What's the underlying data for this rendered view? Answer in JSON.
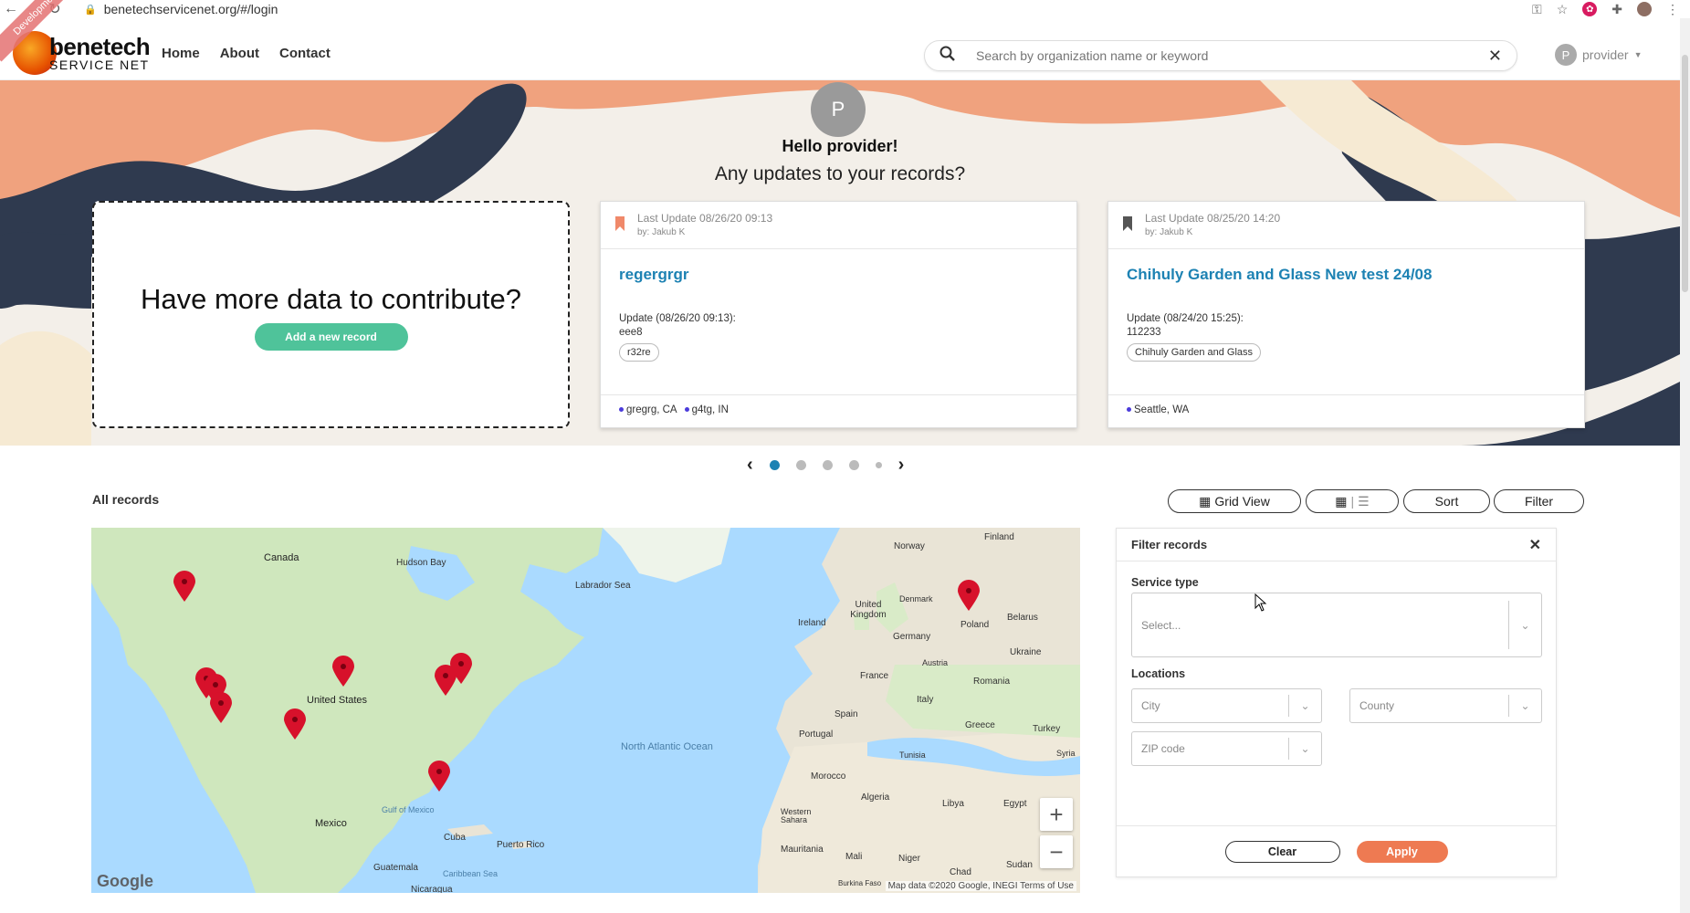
{
  "browser": {
    "url": "benetechservicenet.org/#/login"
  },
  "header": {
    "logo_line1": "benetech",
    "logo_line2": "SERVICE NET",
    "ribbon": "Development",
    "nav": [
      "Home",
      "About",
      "Contact"
    ],
    "search_placeholder": "Search by organization name or keyword",
    "user_initial": "P",
    "user_name": "provider"
  },
  "hero": {
    "avatar_initial": "P",
    "greeting": "Hello provider!",
    "subtitle": "Any updates to your records?"
  },
  "contribute": {
    "title": "Have more data to contribute?",
    "button": "Add a new record"
  },
  "records": [
    {
      "last_update": "Last Update 08/26/20 09:13",
      "by": "by: Jakub K",
      "name": "regergrgr",
      "update_label": "Update (08/26/20 09:13):",
      "update_value": "eee8",
      "tag": "r32re",
      "locations": [
        "gregrg, CA",
        "g4tg, IN"
      ],
      "bookmark_color": "#f0896a"
    },
    {
      "last_update": "Last Update 08/25/20 14:20",
      "by": "by: Jakub K",
      "name": "Chihuly Garden and Glass New test 24/08",
      "update_label": "Update (08/24/20 15:25):",
      "update_value": "112233",
      "tag": "Chihuly Garden and Glass",
      "locations": [
        "Seattle, WA"
      ],
      "bookmark_color": "#555555"
    }
  ],
  "carousel": {
    "pages": 5,
    "active": 0
  },
  "records_section": {
    "title": "All records",
    "grid_view": "Grid View",
    "sort": "Sort",
    "filter": "Filter"
  },
  "map": {
    "labels": {
      "canada": "Canada",
      "hudson": "Hudson Bay",
      "labrador": "Labrador Sea",
      "us": "United States",
      "mexico": "Mexico",
      "gulf": "Gulf of Mexico",
      "cuba": "Cuba",
      "puerto": "Puerto Rico",
      "guatemala": "Guatemala",
      "caribbean": "Caribbean Sea",
      "nicaragua": "Nicaragua",
      "atlantic": "North Atlantic Ocean",
      "finland": "Finland",
      "norway": "Norway",
      "denmark": "Denmark",
      "uk": "United Kingdom",
      "ireland": "Ireland",
      "poland": "Poland",
      "belarus": "Belarus",
      "germany": "Germany",
      "ukraine": "Ukraine",
      "austria": "Austria",
      "france": "France",
      "romania": "Romania",
      "italy": "Italy",
      "spain": "Spain",
      "portugal": "Portugal",
      "greece": "Greece",
      "turkey": "Turkey",
      "syria": "Syria",
      "tunisia": "Tunisia",
      "morocco": "Morocco",
      "algeria": "Algeria",
      "libya": "Libya",
      "egypt": "Egypt",
      "wsahara": "Western Sahara",
      "mauritania": "Mauritania",
      "mali": "Mali",
      "niger": "Niger",
      "chad": "Chad",
      "sudan": "Sudan",
      "burkina": "Burkina Faso"
    },
    "attribution": "Map data ©2020 Google, INEGI   Terms of Use",
    "google": "Google"
  },
  "filter_panel": {
    "title": "Filter records",
    "service_type_label": "Service type",
    "service_type_placeholder": "Select...",
    "locations_label": "Locations",
    "city_placeholder": "City",
    "county_placeholder": "County",
    "zip_placeholder": "ZIP code",
    "clear": "Clear",
    "apply": "Apply"
  },
  "colors": {
    "accent_blue": "#1d82b3",
    "green": "#4fc39a",
    "orange": "#ee7a52",
    "hero_dark": "#2f3a4f",
    "hero_salmon": "#f0a27e",
    "hero_cream": "#f6ead3"
  }
}
